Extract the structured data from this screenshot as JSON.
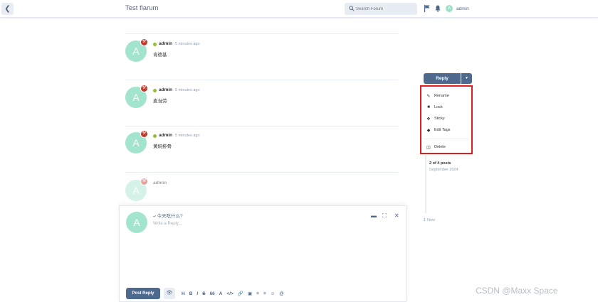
{
  "header": {
    "title": "Test flarum",
    "search_placeholder": "Search Forum",
    "user": {
      "avatar_letter": "A",
      "name": "admin"
    }
  },
  "posts": [
    {
      "avatar_letter": "A",
      "author": "admin",
      "time": "5 minutes ago",
      "content": "肯德基"
    },
    {
      "avatar_letter": "A",
      "author": "admin",
      "time": "5 minutes ago",
      "content": "麦当劳"
    },
    {
      "avatar_letter": "A",
      "author": "admin",
      "time": "5 minutes ago",
      "content": "黄焖排骨"
    }
  ],
  "draft_post": {
    "avatar_letter": "A",
    "author": "admin"
  },
  "composer": {
    "avatar_letter": "A",
    "reply_to": "今天吃什么?",
    "placeholder": "Write a Reply...",
    "submit_label": "Post Reply",
    "format_tools": [
      "H",
      "B",
      "I",
      "S",
      "66",
      "A",
      "</>",
      "link",
      "img",
      "ul",
      "ol",
      "smile",
      "@"
    ]
  },
  "controls": {
    "reply_label": "Reply",
    "menu": [
      {
        "icon": "pencil-icon",
        "label": "Rename"
      },
      {
        "icon": "lock-icon",
        "label": "Lock"
      },
      {
        "icon": "pin-icon",
        "label": "Sticky"
      },
      {
        "icon": "tag-icon",
        "label": "Edit Tags"
      },
      {
        "icon": "trash-icon",
        "label": "Delete"
      }
    ]
  },
  "scrubber": {
    "count": "2 of 4 posts",
    "date": "September 2024",
    "now": "Now"
  },
  "watermark": "CSDN @Maxx Space",
  "colors": {
    "primary": "#4d698e",
    "avatar": "#a3e4cf",
    "badge": "#c0392b",
    "online": "#8fbf2b",
    "highlight": "#e02020"
  }
}
